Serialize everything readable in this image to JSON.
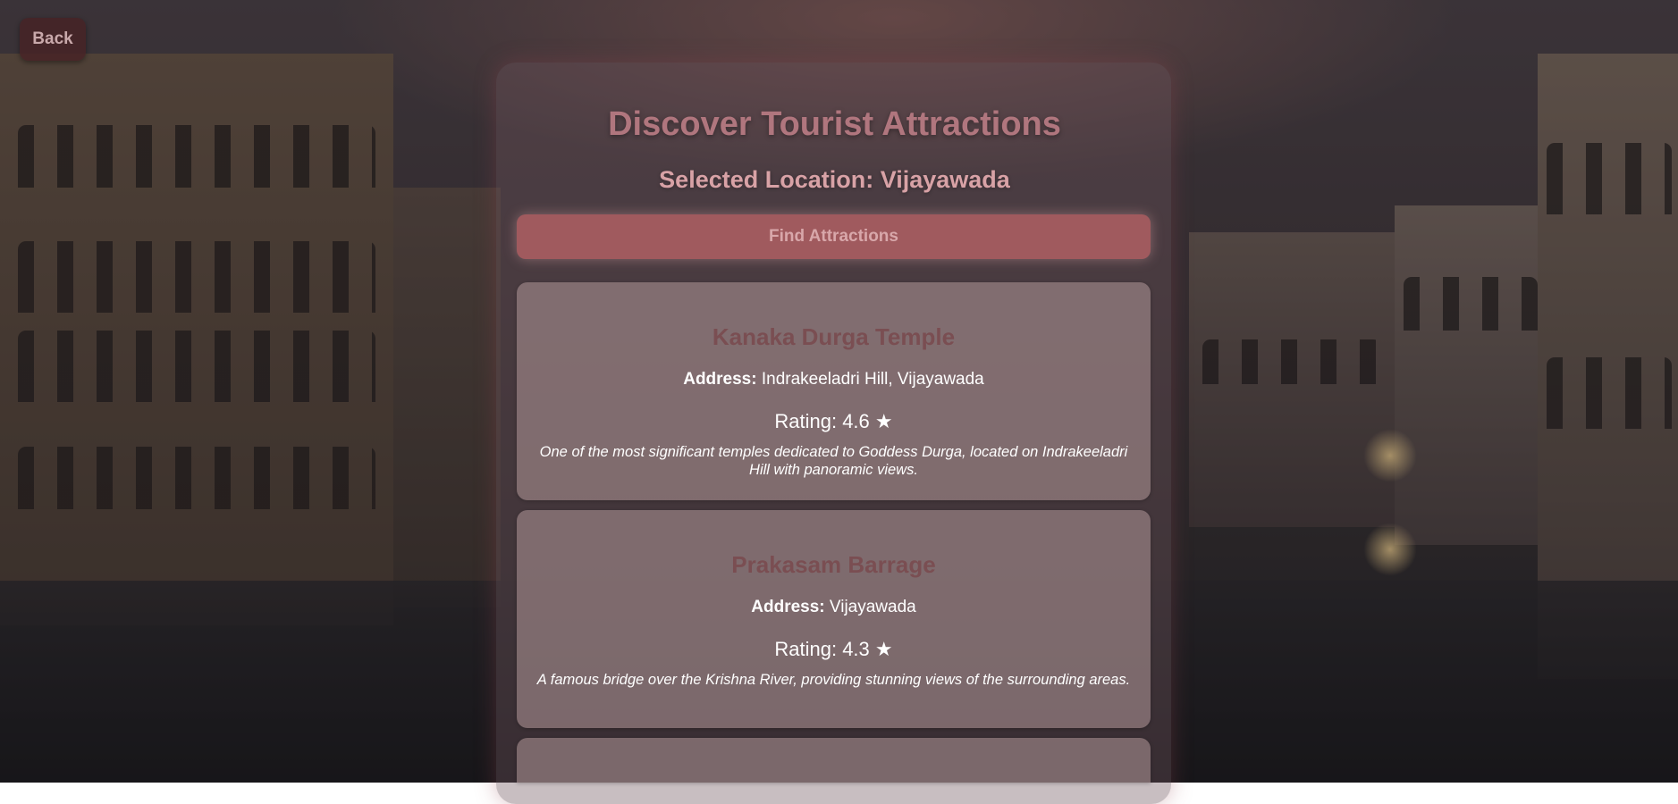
{
  "nav": {
    "back_label": "Back"
  },
  "header": {
    "title": "Discover Tourist Attractions",
    "selected_location": "Selected Location: Vijayawada"
  },
  "action": {
    "find_label": "Find Attractions"
  },
  "attractions": [
    {
      "name": "Kanaka Durga Temple",
      "address_label": "Address:",
      "address": "Indrakeeladri Hill, Vijayawada",
      "rating": "Rating: 4.6 ★",
      "description": "One of the most significant temples dedicated to Goddess Durga, located on Indrakeeladri Hill with panoramic views."
    },
    {
      "name": "Prakasam Barrage",
      "address_label": "Address:",
      "address": "Vijayawada",
      "rating": "Rating: 4.3 ★",
      "description": "A famous bridge over the Krishna River, providing stunning views of the surrounding areas."
    }
  ]
}
